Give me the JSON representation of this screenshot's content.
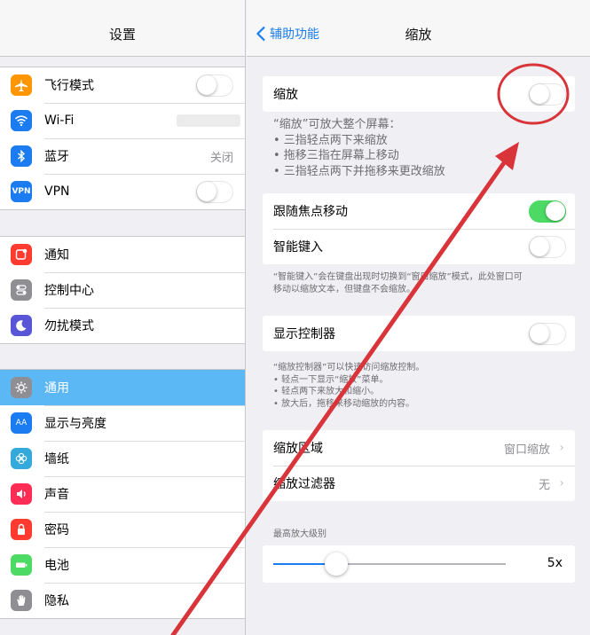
{
  "left": {
    "title": "设置",
    "group1": [
      {
        "label": "飞行模式",
        "icon": "airplane-icon",
        "color": "#ff9500",
        "toggle": false
      },
      {
        "label": "Wi-Fi",
        "icon": "wifi-icon",
        "color": "#1a7cf0",
        "value_redacted": true
      },
      {
        "label": "蓝牙",
        "icon": "bluetooth-icon",
        "color": "#1a7cf0",
        "value": "关闭"
      },
      {
        "label": "VPN",
        "icon": "vpn-icon",
        "color": "#1a7cf0",
        "icon_text": "VPN",
        "toggle": false
      }
    ],
    "group2": [
      {
        "label": "通知",
        "icon": "notifications-icon",
        "color": "#ff3b30"
      },
      {
        "label": "控制中心",
        "icon": "control-center-icon",
        "color": "#8e8e93"
      },
      {
        "label": "勿扰模式",
        "icon": "moon-icon",
        "color": "#5856d6"
      }
    ],
    "group3": [
      {
        "label": "通用",
        "icon": "gear-icon",
        "color": "#8e8e93",
        "selected": true
      },
      {
        "label": "显示与亮度",
        "icon": "display-brightness-icon",
        "color": "#1a7cf0",
        "icon_text": "AA"
      },
      {
        "label": "墙纸",
        "icon": "wallpaper-icon",
        "color": "#34aadc"
      },
      {
        "label": "声音",
        "icon": "speaker-icon",
        "color": "#ff2d55"
      },
      {
        "label": "密码",
        "icon": "lock-icon",
        "color": "#ff3b30"
      },
      {
        "label": "电池",
        "icon": "battery-icon",
        "color": "#4cd964"
      },
      {
        "label": "隐私",
        "icon": "hand-icon",
        "color": "#8e8e93"
      }
    ]
  },
  "right": {
    "back_label": "辅助功能",
    "title": "缩放",
    "zoom_label": "缩放",
    "zoom_on": false,
    "zoom_footer": [
      "“缩放”可放大整个屏幕：",
      "• 三指轻点两下来缩放",
      "• 拖移三指在屏幕上移动",
      "• 三指轻点两下并拖移来更改缩放"
    ],
    "follow_focus_label": "跟随焦点移动",
    "follow_focus_on": true,
    "smart_typing_label": "智能键入",
    "smart_typing_on": false,
    "smart_footer": [
      "“智能键入”会在键盘出现时切换到“窗口缩放”模式，此处窗口可",
      "移动以缩放文本，但键盘不会缩放。"
    ],
    "show_controller_label": "显示控制器",
    "show_controller_on": false,
    "controller_footer": [
      "“缩放控制器”可以快速访问缩放控制。",
      "• 轻点一下显示“缩放”菜单。",
      "• 轻点两下来放大和缩小。",
      "• 放大后，拖移来移动缩放的内容。"
    ],
    "zoom_region_label": "缩放区域",
    "zoom_region_value": "窗口缩放",
    "zoom_filter_label": "缩放过滤器",
    "zoom_filter_value": "无",
    "max_zoom_header": "最高放大级别",
    "max_zoom_value": "5x",
    "max_zoom_fraction": 0.27
  },
  "colors": {
    "accent": "#1a7cf0",
    "toggle_on": "#4cd964",
    "annotation": "#d9343a"
  }
}
